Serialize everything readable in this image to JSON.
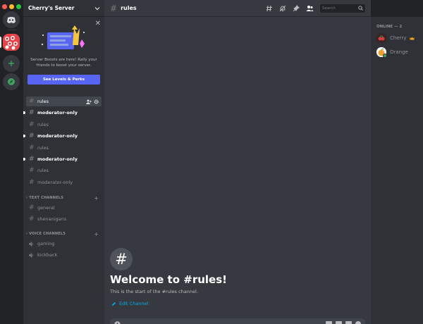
{
  "window": {
    "traffic_colors": [
      "#ff5f57",
      "#febc2e",
      "#28c840"
    ]
  },
  "servers": [
    {
      "name": "home",
      "icon": "discord-logo-icon"
    },
    {
      "name": "cherry-server",
      "icon": "cherry-server-icon"
    },
    {
      "name": "add-server",
      "icon": "plus-icon",
      "color": "#3ba55d"
    },
    {
      "name": "explore",
      "icon": "compass-icon",
      "color": "#3ba55d"
    }
  ],
  "server": {
    "name": "Cherry's Server"
  },
  "boost": {
    "text": "Server Boosts are here! Rally your friends to boost your server.",
    "button": "See Levels & Perks"
  },
  "channels": [
    {
      "name": "rules",
      "state": "selected"
    },
    {
      "name": "moderator-only",
      "state": "unread"
    },
    {
      "name": "rules",
      "state": "normal"
    },
    {
      "name": "moderator-only",
      "state": "unread"
    },
    {
      "name": "rules",
      "state": "normal"
    },
    {
      "name": "moderator-only",
      "state": "unread"
    },
    {
      "name": "rules",
      "state": "normal"
    },
    {
      "name": "moderator-only",
      "state": "normal"
    }
  ],
  "categories": {
    "text": {
      "label": "TEXT CHANNELS",
      "channels": [
        "general",
        "shenanigans"
      ]
    },
    "voice": {
      "label": "VOICE CHANNELS",
      "channels": [
        "gaming",
        "kickback"
      ]
    }
  },
  "chat": {
    "channel": "rules",
    "search_placeholder": "Search",
    "welcome_title": "Welcome to #rules!",
    "welcome_sub": "This is the start of the #rules channel.",
    "edit_link": "Edit Channel"
  },
  "members": {
    "header": "ONLINE — 2",
    "list": [
      {
        "name": "Cherry",
        "badge": "crown-icon",
        "avatar_color": "#d83c3e"
      },
      {
        "name": "Orange",
        "avatar_color": "#f0a030"
      }
    ]
  },
  "colors": {
    "accent": "#5865f2",
    "link": "#00aff4",
    "online": "#3ba55d"
  }
}
